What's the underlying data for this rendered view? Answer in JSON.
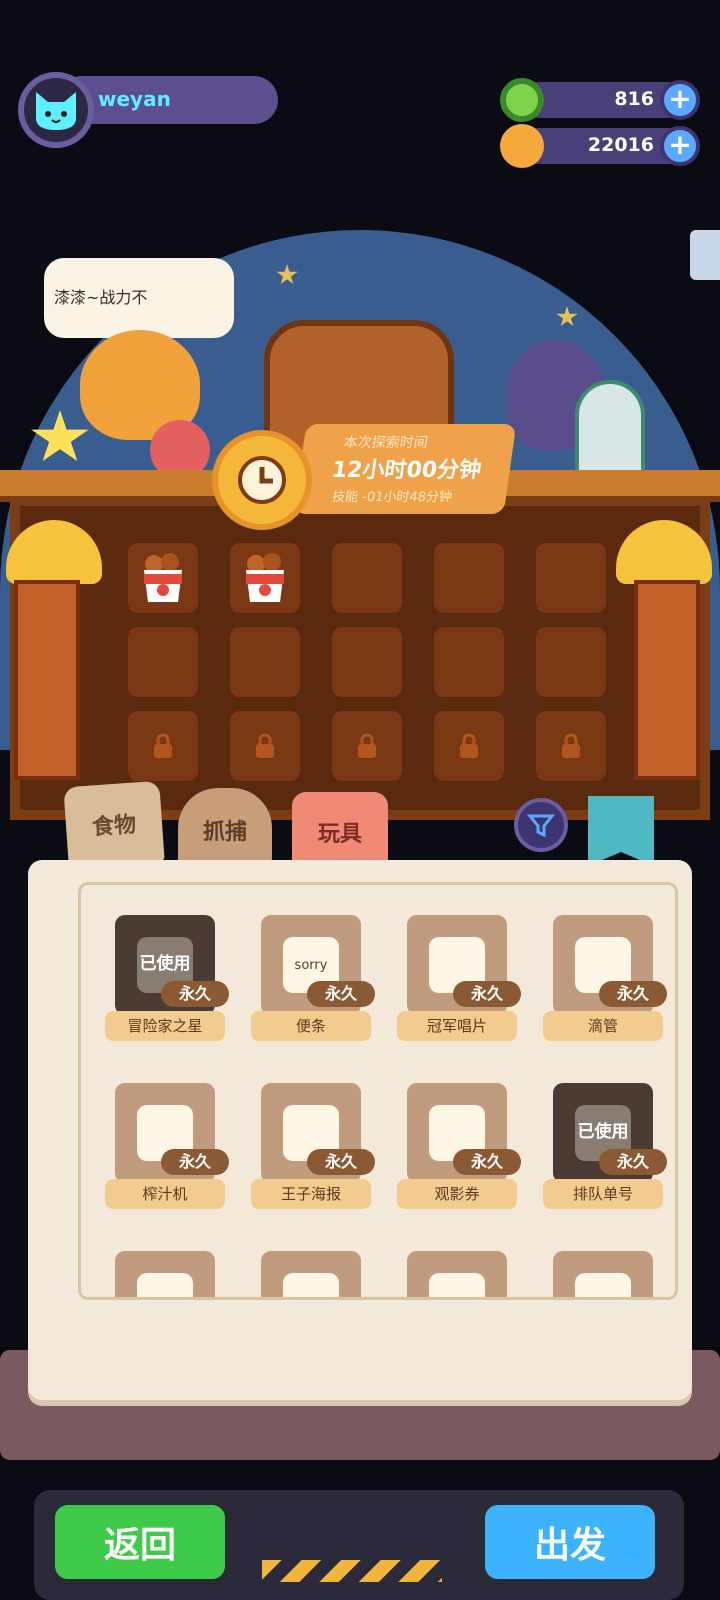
{
  "player": {
    "name": "weyan",
    "avatar_icon": "cat-face-icon"
  },
  "currencies": [
    {
      "icon": "green-donut-icon",
      "value": "816"
    },
    {
      "icon": "gold-planet-icon",
      "value": "22016"
    }
  ],
  "scene": {
    "speech": "漆漆~战力不",
    "timer": {
      "title": "本次探索时间",
      "duration": "12小时00分钟",
      "skill": "技能 -01小时48分钟"
    },
    "slots": [
      "food-bucket",
      "food-bucket",
      "empty",
      "empty",
      "empty",
      "empty",
      "empty",
      "empty",
      "empty",
      "empty",
      "locked",
      "locked",
      "locked",
      "locked",
      "locked"
    ]
  },
  "tabs": [
    {
      "label": "食物"
    },
    {
      "label": "抓捕"
    },
    {
      "label": "玩具"
    }
  ],
  "items": [
    {
      "name": "冒险家之星",
      "badge": "永久",
      "used": "已使用",
      "icon": "green-star-icon"
    },
    {
      "name": "便条",
      "badge": "永久",
      "used": "",
      "icon": "sorry-note-icon",
      "note_text": "sorry"
    },
    {
      "name": "冠军唱片",
      "badge": "永久",
      "used": "",
      "icon": "record-icon"
    },
    {
      "name": "滴管",
      "badge": "永久",
      "used": "",
      "icon": "dropper-icon"
    },
    {
      "name": "榨汁机",
      "badge": "永久",
      "used": "",
      "icon": "juicer-icon"
    },
    {
      "name": "王子海报",
      "badge": "永久",
      "used": "",
      "icon": "prince-poster-icon"
    },
    {
      "name": "观影券",
      "badge": "永久",
      "used": "",
      "icon": "ticket-icon"
    },
    {
      "name": "排队单号",
      "badge": "永久",
      "used": "已使用",
      "icon": "queue-slip-icon"
    },
    {
      "name": "",
      "badge": "",
      "used": "",
      "icon": "cookie-icon"
    },
    {
      "name": "",
      "badge": "",
      "used": "",
      "icon": "card-icon"
    },
    {
      "name": "",
      "badge": "",
      "used": "",
      "icon": "paper-icon"
    },
    {
      "name": "",
      "badge": "",
      "used": "",
      "icon": "pen-icon"
    }
  ],
  "buttons": {
    "back": "返回",
    "go": "出发"
  },
  "colors": {
    "go": "#3db2ff",
    "back": "#3ecb4a",
    "page": "#f3e9da"
  }
}
